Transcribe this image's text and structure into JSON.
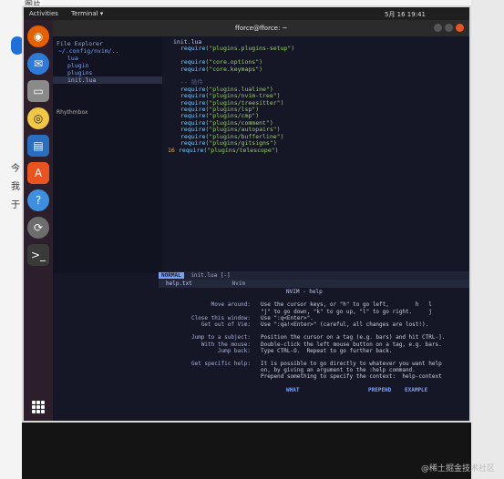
{
  "caption": "图片",
  "side_chars": [
    "今",
    "我",
    "于"
  ],
  "topbar": {
    "activities": "Activities",
    "app": "Terminal ▾",
    "clock": "5月 16  19:41"
  },
  "terminal_title": "fforce@fforce: ~",
  "dock": [
    "firefox-icon",
    "thunderbird-icon",
    "files-icon",
    "rhythmbox-icon",
    "writer-icon",
    "software-icon",
    "help-icon",
    "update-icon",
    "terminal-icon"
  ],
  "tooltip": "Rhythmbox",
  "file_explorer": {
    "header": "File Explorer",
    "path": "~/.config/nvim/..",
    "items": [
      {
        "name": "lua",
        "type": "dir"
      },
      {
        "name": "plugin",
        "type": "dir"
      },
      {
        "name": "plugins",
        "type": "dir"
      },
      {
        "name": "init.lua",
        "type": "file",
        "selected": true
      }
    ]
  },
  "editor": {
    "tab": "init.lua",
    "lines": [
      {
        "n": "",
        "fn": "require",
        "arg": "(\"plugins.plugins-setup\")"
      },
      {
        "n": "",
        "fn": "",
        "arg": ""
      },
      {
        "n": "",
        "fn": "require",
        "arg": "(\"core.options\")"
      },
      {
        "n": "",
        "fn": "require",
        "arg": "(\"core.keymaps\")"
      },
      {
        "n": "",
        "fn": "",
        "arg": ""
      },
      {
        "n": "",
        "cmt": "-- 插件"
      },
      {
        "n": "",
        "fn": "require",
        "arg": "(\"plugins.lualine\")"
      },
      {
        "n": "",
        "fn": "require",
        "arg": "(\"plugins/nvim-tree\")"
      },
      {
        "n": "",
        "fn": "require",
        "arg": "(\"plugins/treesitter\")"
      },
      {
        "n": "",
        "fn": "require",
        "arg": "(\"plugins/lsp\")"
      },
      {
        "n": "",
        "fn": "require",
        "arg": "(\"plugins/cmp\")"
      },
      {
        "n": "",
        "fn": "require",
        "arg": "(\"plugins/comment\")"
      },
      {
        "n": "",
        "fn": "require",
        "arg": "(\"plugins/autopairs\")"
      },
      {
        "n": "",
        "fn": "require",
        "arg": "(\"plugins/bufferline\")"
      },
      {
        "n": "",
        "fn": "require",
        "arg": "(\"plugins/gitsigns\")"
      },
      {
        "n": "16",
        "fn": "require",
        "arg": "(\"plugins/telescope\")"
      }
    ]
  },
  "statusbar": {
    "mode": "NORMAL",
    "file": "init.lua [-]"
  },
  "helpbar": {
    "left": "help.txt",
    "right": "Nvim"
  },
  "help": {
    "title": "NVIM - help",
    "rows": [
      {
        "label": "Move around:",
        "text": "Use the cursor keys, or \"h\" to go left,        h   l"
      },
      {
        "label": "",
        "text": "\"j\" to go down, \"k\" to go up, \"l\" to go right.     j"
      },
      {
        "label": "Close this window:",
        "text": "Use \":q<Enter>\"."
      },
      {
        "label": "Get out of Vim:",
        "text": "Use \":qa!<Enter>\" (careful, all changes are lost!)."
      },
      {
        "label": "",
        "text": ""
      },
      {
        "label": "Jump to a subject:",
        "text": "Position the cursor on a tag (e.g. bars) and hit CTRL-]."
      },
      {
        "label": "With the mouse:",
        "text": "Double-click the left mouse button on a tag, e.g. bars."
      },
      {
        "label": "Jump back:",
        "text": "Type CTRL-O.  Repeat to go further back."
      },
      {
        "label": "",
        "text": ""
      },
      {
        "label": "Get specific help:",
        "text": "It is possible to go directly to whatever you want help"
      },
      {
        "label": "",
        "text": "on, by giving an argument to the :help command."
      },
      {
        "label": "",
        "text": "Prepend something to specify the context:  help-context"
      }
    ],
    "tags": [
      "WHAT",
      "PREPEND",
      "EXAMPLE"
    ]
  },
  "watermark": "@稀土掘金技术社区"
}
